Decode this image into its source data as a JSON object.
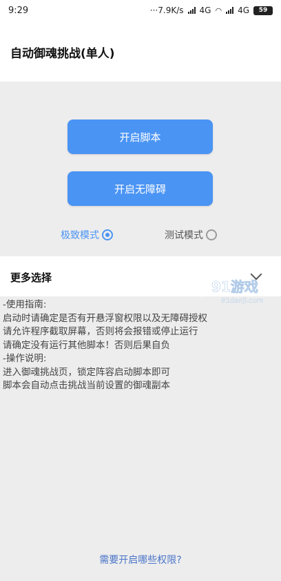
{
  "status_bar": {
    "time": "9:29",
    "speed": "7.9K/s",
    "network1": "4G",
    "network2": "4G",
    "battery": "59"
  },
  "app_bar": {
    "title": "自动御魂挑战(单人)"
  },
  "buttons": {
    "start_script": "开启脚本",
    "enable_accessibility": "开启无障碍"
  },
  "modes": {
    "extreme": "极致模式",
    "test": "测试模式",
    "selected": "extreme"
  },
  "more_options": {
    "label": "更多选择"
  },
  "guide": {
    "lines": [
      "-使用指南:",
      "启动时请确定是否有开悬浮窗权限以及无障碍授权",
      "请允许程序截取屏幕，否则将会报错或停止运行",
      "请确定没有运行其他脚本！否则后果自负",
      "-操作说明:",
      "进入御魂挑战页，锁定阵容启动脚本即可",
      "脚本会自动点击挑战当前设置的御魂副本"
    ]
  },
  "footer": {
    "permissions_link": "需要开启哪些权限?"
  },
  "watermark": {
    "brand": "91游戏",
    "site": "91danji.com"
  },
  "colors": {
    "accent": "#4a94f4",
    "link": "#4a74c8",
    "background": "#ededed"
  }
}
